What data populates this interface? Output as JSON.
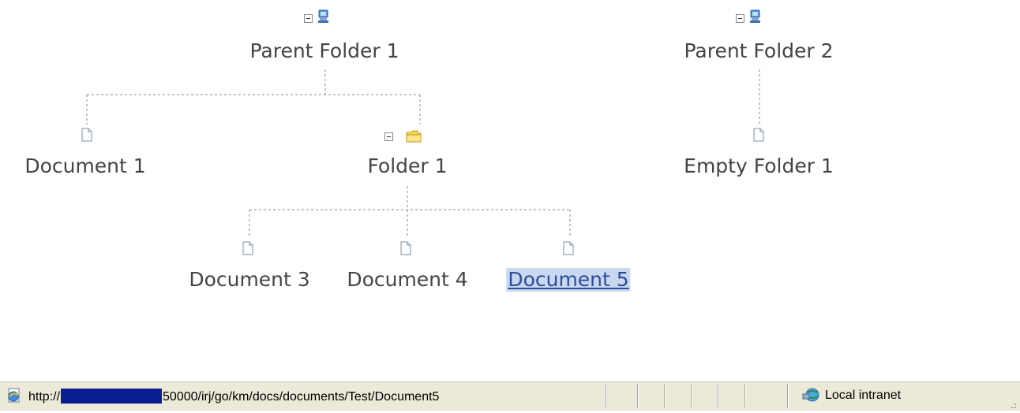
{
  "tree": {
    "parents": [
      {
        "label": "Parent Folder 1",
        "icon": "network-computer-icon",
        "expanded": true
      },
      {
        "label": "Parent Folder 2",
        "icon": "network-computer-icon",
        "expanded": true
      }
    ],
    "children": {
      "document_1": {
        "label": "Document 1",
        "icon": "document-icon"
      },
      "folder_1": {
        "label": "Folder 1",
        "icon": "folder-icon",
        "expanded": true
      },
      "empty_folder_1": {
        "label": "Empty Folder 1",
        "icon": "document-icon"
      },
      "document_3": {
        "label": "Document 3",
        "icon": "document-icon"
      },
      "document_4": {
        "label": "Document 4",
        "icon": "document-icon"
      },
      "document_5": {
        "label": "Document 5",
        "icon": "document-icon",
        "selected": true
      }
    }
  },
  "statusbar": {
    "url_prefix": "http://",
    "url_rest": "50000/irj/go/km/docs/documents/Test/Document5",
    "zone": "Local intranet"
  },
  "colors": {
    "selection_bg": "#c9d7ef",
    "statusbar_bg": "#ece9d8",
    "connector": "#888888"
  }
}
